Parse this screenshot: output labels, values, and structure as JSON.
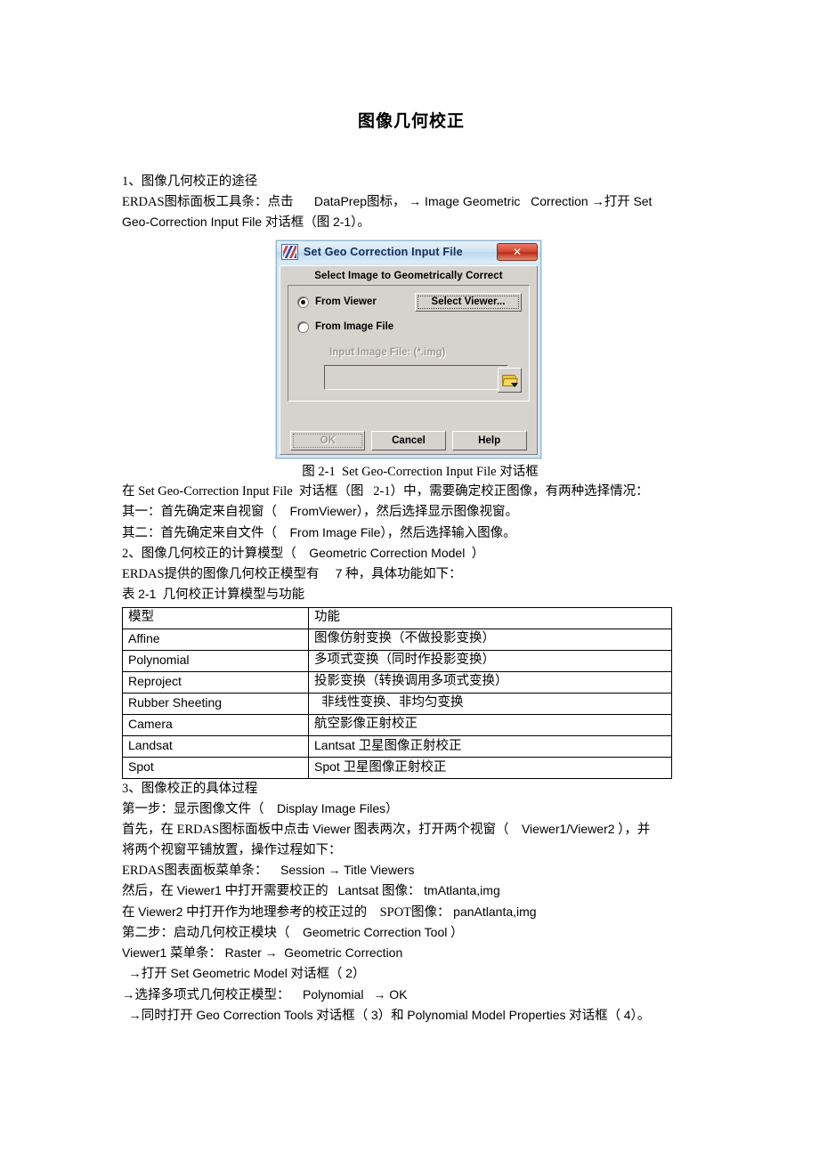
{
  "document": {
    "title": "图像几何校正"
  },
  "section1": {
    "heading": "1、图像几何校正的途径",
    "line1_a": "ERDAS图标面板工具条：点击",
    "line1_b": "DataPrep",
    "line1_c": "图标，",
    "line1_d": "→ Image Geometric   Correction",
    "line1_e": "→打开",
    "line1_f": "Set",
    "line2_a": "Geo-Correction Input File",
    "line2_b": "对话框（图",
    "line2_c": "2-1",
    "line2_d": "）。"
  },
  "dialog": {
    "title": "Set Geo Correction Input File",
    "close_label": "✕",
    "icon_name": "erdas-app-icon",
    "caption": "Select Image to Geometrically Correct",
    "radio_from_viewer": "From Viewer",
    "radio_from_image_file": "From Image File",
    "select_viewer_button": "Select Viewer...",
    "input_image_label": "Input Image File: (*.img)",
    "input_image_value": "",
    "ok_button": "OK",
    "cancel_button": "Cancel",
    "help_button": "Help",
    "folder_icon": "open-folder-icon",
    "titlebar_color": "#cfe4f4",
    "close_button_color": "#d64a32",
    "body_color": "#d6d3ce"
  },
  "figure_caption": {
    "prefix": "图",
    "number": "2-1",
    "name": "Set Geo-Correction Input File",
    "suffix": "对话框"
  },
  "section1b": {
    "line1": "在 Set Geo-Correction Input File  对话框（图   2-1）中，需要确定校正图像，有两种选择情况：",
    "line2_a": "其一：首先确定来自视窗（",
    "line2_b": "FromViewer",
    "line2_c": "），然后选择显示图像视窗。",
    "line3_a": "其二：首先确定来自文件（",
    "line3_b": "From Image File",
    "line3_c": "），然后选择输入图像。"
  },
  "section2": {
    "heading_a": "2、图像几何校正的计算模型（",
    "heading_b": "Geometric Correction Model",
    "heading_c": "）",
    "line1_a": "ERDAS提供的图像几何校正模型有",
    "line1_b": "7",
    "line1_c": "种，具体功能如下：",
    "table_caption_a": "表",
    "table_caption_b": "2-1",
    "table_caption_c": "几何校正计算模型与功能"
  },
  "table": {
    "headers": [
      "模型",
      "功能"
    ],
    "rows": [
      {
        "model": "Affine",
        "model_en": true,
        "func": "图像仿射变换（不做投影变换）"
      },
      {
        "model": "Polynomial",
        "model_en": true,
        "func": "多项式变换（同时作投影变换）"
      },
      {
        "model": "Reproject",
        "model_en": true,
        "func": "投影变换（转换调用多项式变换）"
      },
      {
        "model": "Rubber Sheeting",
        "model_en": true,
        "func": "非线性变换、非均匀变换",
        "indent": true
      },
      {
        "model": "Camera",
        "model_en": true,
        "func": "航空影像正射校正"
      },
      {
        "model": "Landsat",
        "model_en": true,
        "func_en": "Lantsat",
        "func": "卫星图像正射校正"
      },
      {
        "model": "Spot",
        "model_en": true,
        "func_en": "Spot",
        "func": "卫星图像正射校正"
      }
    ]
  },
  "section3": {
    "heading": "3、图像校正的具体过程",
    "step1_a": "第一步：显示图像文件（",
    "step1_b": "Display Image Files）",
    "p1_a": "首先，在",
    "p1_b": "ERDAS图标面板中点击",
    "p1_c": "Viewer",
    "p1_d": "图表两次，打开两个视窗（",
    "p1_e": "Viewer1/Viewer2",
    "p1_f": "），并",
    "p2": "将两个视窗平铺放置，操作过程如下：",
    "p3_a": "ERDAS图表面板菜单条：",
    "p3_b": "Session",
    "p3_c": "→ Title Viewers",
    "p4_a": "然后，在",
    "p4_b": "Viewer1",
    "p4_c": "中打开需要校正的",
    "p4_d": "Lantsat",
    "p4_e": "图像：",
    "p4_f": "tmAtlanta,img",
    "p5_a": "在",
    "p5_b": "Viewer2",
    "p5_c": "中打开作为地理参考的校正过的",
    "p5_d": "SPOT图像：",
    "p5_e": "panAtlanta,img",
    "step2_a": "第二步：启动几何校正模块（",
    "step2_b": "Geometric Correction Tool",
    "step2_c": "）",
    "p6_a": "Viewer1",
    "p6_b": "菜单条：",
    "p6_c": "Raster",
    "p6_d": "→  Geometric Correction",
    "p7_a": "→打开",
    "p7_b": "Set Geometric Model",
    "p7_c": "对话框（",
    "p7_d": "2",
    "p7_e": "）",
    "p8_a": "→选择多项式几何校正模型：",
    "p8_b": "Polynomial",
    "p8_c": "→ OK",
    "p9_a": "→同时打开",
    "p9_b": "Geo Correction Tools",
    "p9_c": "对话框（",
    "p9_d": "3",
    "p9_e": "）和",
    "p9_f": "Polynomial Model Properties",
    "p9_g": "对话框（",
    "p9_h": "4",
    "p9_i": "）。"
  }
}
